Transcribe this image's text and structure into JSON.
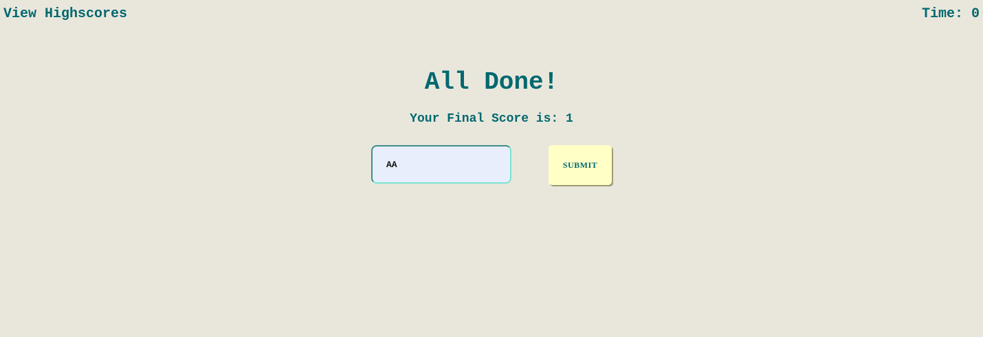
{
  "header": {
    "view_highscores_label": "View Highscores",
    "timer_text": "Time: 0"
  },
  "main": {
    "title": "All Done!",
    "final_score_text": "Your Final Score is: 1"
  },
  "form": {
    "initials_value": "AA",
    "submit_label": "SUBMIT"
  },
  "colors": {
    "background": "#e9e7dc",
    "accent": "#00686f",
    "input_background": "#e8eefb",
    "button_background": "#ffffc6"
  }
}
